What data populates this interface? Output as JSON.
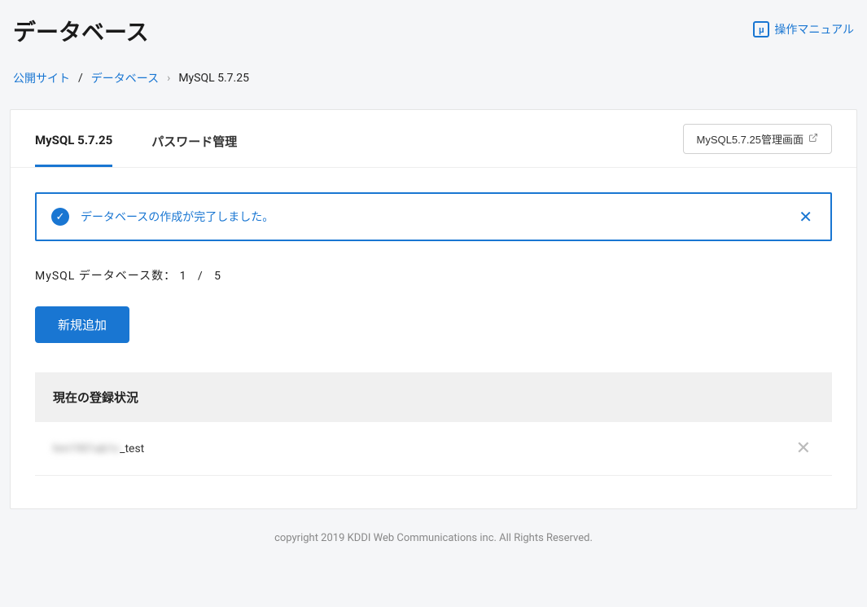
{
  "header": {
    "title": "データベース",
    "manual_link": "操作マニュアル"
  },
  "breadcrumb": {
    "link1": "公開サイト",
    "link2": "データベース",
    "current": "MySQL 5.7.25"
  },
  "tabs": {
    "tab1": "MySQL 5.7.25",
    "tab2": "パスワード管理",
    "admin_button": "MySQL5.7.25管理画面"
  },
  "alert": {
    "message": "データベースの作成が完了しました。"
  },
  "db_count": {
    "label": "MySQL データベース数：",
    "current": "1",
    "sep": "/",
    "max": "5"
  },
  "add_button": "新規追加",
  "section_title": "現在の登録状況",
  "databases": [
    {
      "prefix": "hm1901ab1c",
      "suffix": "_test"
    }
  ],
  "footer": "copyright 2019 KDDI Web Communications inc. All Rights Reserved."
}
